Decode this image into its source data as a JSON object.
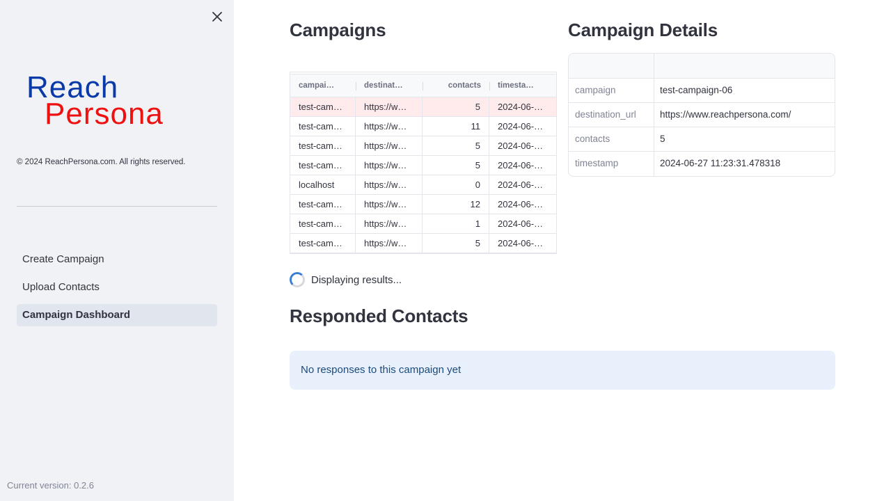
{
  "sidebar": {
    "close_icon": "close-icon",
    "logo": {
      "line1": "Reach",
      "line2": "Persona",
      "color1": "#0a3aa8",
      "color2": "#ee1111"
    },
    "copyright": "© 2024 ReachPersona.com. All rights reserved.",
    "nav": [
      {
        "label": "Create Campaign",
        "active": false
      },
      {
        "label": "Upload Contacts",
        "active": false
      },
      {
        "label": "Campaign Dashboard",
        "active": true
      }
    ],
    "version": "Current version: 0.2.6"
  },
  "campaigns": {
    "title": "Campaigns",
    "columns": [
      "campai…",
      "destinat…",
      "contacts",
      "timesta…"
    ],
    "rows": [
      [
        "test-camp…",
        "https://w…",
        "5",
        "2024-06-2…"
      ],
      [
        "test-camp…",
        "https://w…",
        "11",
        "2024-06-2…"
      ],
      [
        "test-camp…",
        "https://w…",
        "5",
        "2024-06-2…"
      ],
      [
        "test-camp…",
        "https://w…",
        "5",
        "2024-06-2…"
      ],
      [
        "localhost",
        "https://w…",
        "0",
        "2024-06-2…"
      ],
      [
        "test-camp…",
        "https://w…",
        "12",
        "2024-06-2…"
      ],
      [
        "test-camp…",
        "https://w…",
        "1",
        "2024-06-2…"
      ],
      [
        "test-camp…",
        "https://w…",
        "5",
        "2024-06-2…"
      ]
    ],
    "selected_row": 0,
    "status": "Displaying results..."
  },
  "details": {
    "title": "Campaign Details",
    "rows": [
      {
        "key": "campaign",
        "value": "test-campaign-06"
      },
      {
        "key": "destination_url",
        "value": "https://www.reachpersona.com/"
      },
      {
        "key": "contacts",
        "value": "5"
      },
      {
        "key": "timestamp",
        "value": "2024-06-27 11:23:31.478318"
      }
    ]
  },
  "responded": {
    "title": "Responded Contacts",
    "message": "No responses to this campaign yet"
  }
}
